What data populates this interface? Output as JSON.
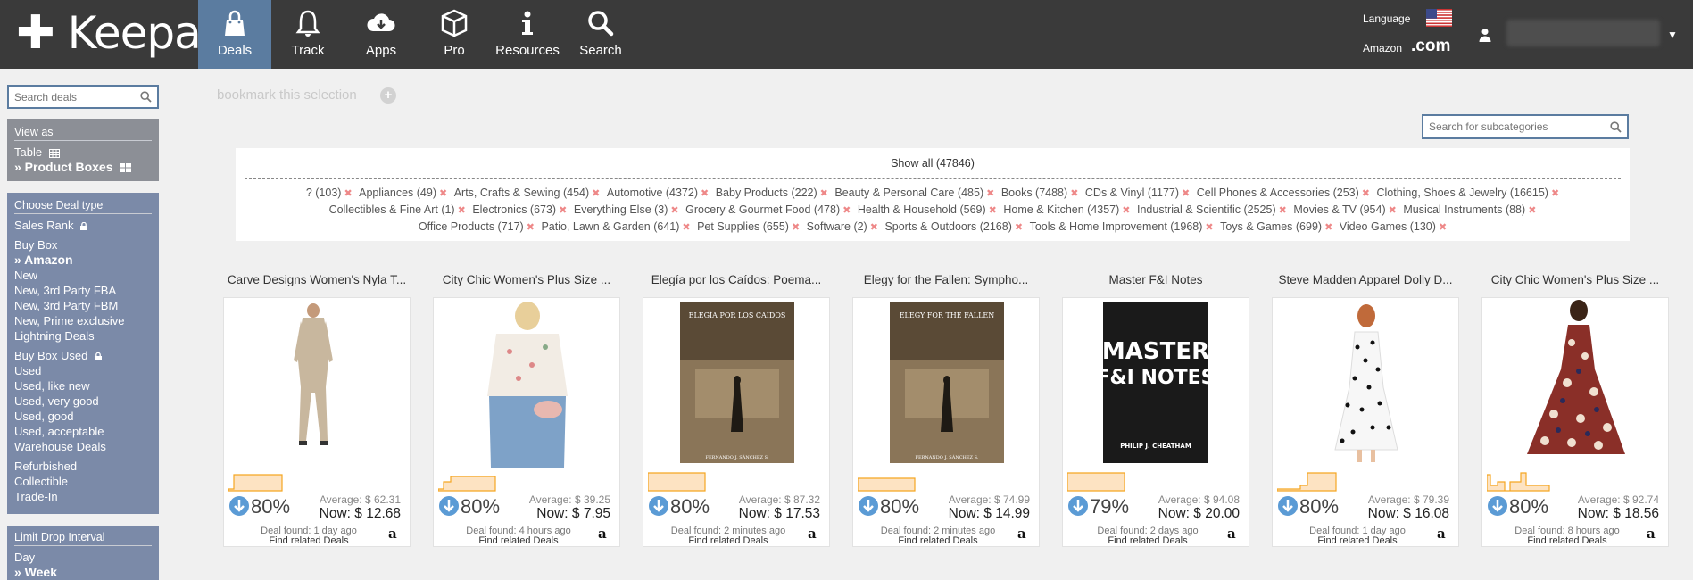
{
  "header": {
    "logo_text": "Keepa",
    "nav": [
      {
        "label": "Deals",
        "icon": "shopping-bag-icon",
        "active": true
      },
      {
        "label": "Track",
        "icon": "bell-icon"
      },
      {
        "label": "Apps",
        "icon": "cloud-download-icon"
      },
      {
        "label": "Pro",
        "icon": "box-icon"
      },
      {
        "label": "Resources",
        "icon": "info-icon"
      },
      {
        "label": "Search",
        "icon": "search-icon"
      }
    ],
    "language_label": "Language",
    "amazon_label": "Amazon",
    "domain": ".com"
  },
  "sidebar": {
    "search_placeholder": "Search deals",
    "view_as": {
      "heading": "View as",
      "items": [
        "Table",
        "» Product Boxes"
      ]
    },
    "deal_type": {
      "heading": "Choose Deal type",
      "items": [
        "Sales Rank",
        "Buy Box",
        "» Amazon",
        "New",
        "New, 3rd Party FBA",
        "New, 3rd Party FBM",
        "New, Prime exclusive",
        "Lightning Deals",
        "Buy Box Used",
        "Used",
        "Used, like new",
        "Used, very good",
        "Used, good",
        "Used, acceptable",
        "Warehouse Deals",
        "Refurbished",
        "Collectible",
        "Trade-In"
      ]
    },
    "drop_interval": {
      "heading": "Limit Drop Interval",
      "items": [
        "Day",
        "» Week"
      ]
    }
  },
  "main": {
    "bookmark_text": "bookmark this selection",
    "subcategory_placeholder": "Search for subcategories",
    "show_all": "Show all (47846)",
    "categories": [
      "? (103)",
      "Appliances (49)",
      "Arts, Crafts & Sewing (454)",
      "Automotive (4372)",
      "Baby Products (222)",
      "Beauty & Personal Care (485)",
      "Books (7488)",
      "CDs & Vinyl (1177)",
      "Cell Phones & Accessories (253)",
      "Clothing, Shoes & Jewelry (16615)",
      "Collectibles & Fine Art (1)",
      "Electronics (673)",
      "Everything Else (3)",
      "Grocery & Gourmet Food (478)",
      "Health & Household (569)",
      "Home & Kitchen (4357)",
      "Industrial & Scientific (2525)",
      "Movies & TV (954)",
      "Musical Instruments (88)",
      "Office Products (717)",
      "Patio, Lawn & Garden (641)",
      "Pet Supplies (655)",
      "Software (2)",
      "Sports & Outdoors (2168)",
      "Tools & Home Improvement (1968)",
      "Toys & Games (699)",
      "Video Games (130)"
    ],
    "products": [
      {
        "title": "Carve Designs Women's Nyla T...",
        "drop": "80%",
        "average": "Average: $ 62.31",
        "now": "Now: $ 12.68",
        "found": "Deal found: 1 day ago",
        "related": "Find related Deals"
      },
      {
        "title": "City Chic Women's Plus Size ...",
        "drop": "80%",
        "average": "Average: $ 39.25",
        "now": "Now: $ 7.95",
        "found": "Deal found: 4 hours ago",
        "related": "Find related Deals"
      },
      {
        "title": "Elegía por los Caídos: Poema...",
        "drop": "80%",
        "average": "Average: $ 87.32",
        "now": "Now: $ 17.53",
        "found": "Deal found: 2 minutes ago",
        "related": "Find related Deals",
        "cover_title": "ELEGÍA POR LOS CAÍDOS",
        "cover_author": "FERNANDO J. SÁNCHEZ S."
      },
      {
        "title": "Elegy for the Fallen: Sympho...",
        "drop": "80%",
        "average": "Average: $ 74.99",
        "now": "Now: $ 14.99",
        "found": "Deal found: 2 minutes ago",
        "related": "Find related Deals",
        "cover_title": "ELEGY FOR THE FALLEN",
        "cover_author": "FERNANDO J. SÁNCHEZ S."
      },
      {
        "title": "Master F&I Notes",
        "drop": "79%",
        "average": "Average: $ 94.08",
        "now": "Now: $ 20.00",
        "found": "Deal found: 2 days ago",
        "related": "Find related Deals",
        "cover_title_1": "MASTER",
        "cover_title_2": "F&I NOTES",
        "cover_author": "PHILIP J. CHEATHAM"
      },
      {
        "title": "Steve Madden Apparel Dolly D...",
        "drop": "80%",
        "average": "Average: $ 79.39",
        "now": "Now: $ 16.08",
        "found": "Deal found: 1 day ago",
        "related": "Find related Deals"
      },
      {
        "title": "City Chic Women's Plus Size ...",
        "drop": "80%",
        "average": "Average: $ 92.74",
        "now": "Now: $ 18.56",
        "found": "Deal found: 8 hours ago",
        "related": "Find related Deals"
      }
    ]
  },
  "colors": {
    "topbar": "#3a3a3a",
    "active_nav": "#5b7ca0",
    "chart_orange": "#f5a623",
    "drop_blue": "#5b9bd5"
  }
}
